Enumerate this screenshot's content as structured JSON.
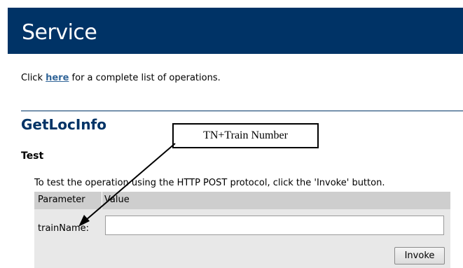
{
  "header": {
    "title": "Service"
  },
  "intro": {
    "prefix": "Click ",
    "link_label": "here",
    "suffix": " for a complete list of operations."
  },
  "operation": {
    "name": "GetLocInfo"
  },
  "test": {
    "heading": "Test",
    "instruction": "To test the operation using the HTTP POST protocol, click the 'Invoke' button.",
    "columns": {
      "parameter": "Parameter",
      "value": "Value"
    },
    "parameters": [
      {
        "label": "trainName:",
        "value": "",
        "placeholder": ""
      }
    ],
    "invoke_label": "Invoke"
  },
  "annotation": {
    "callout_text": "TN+Train Number"
  },
  "colors": {
    "banner": "#003366",
    "link": "#336699",
    "heading": "#003366",
    "table_header": "#cecece",
    "table_body": "#e8e8e8"
  }
}
